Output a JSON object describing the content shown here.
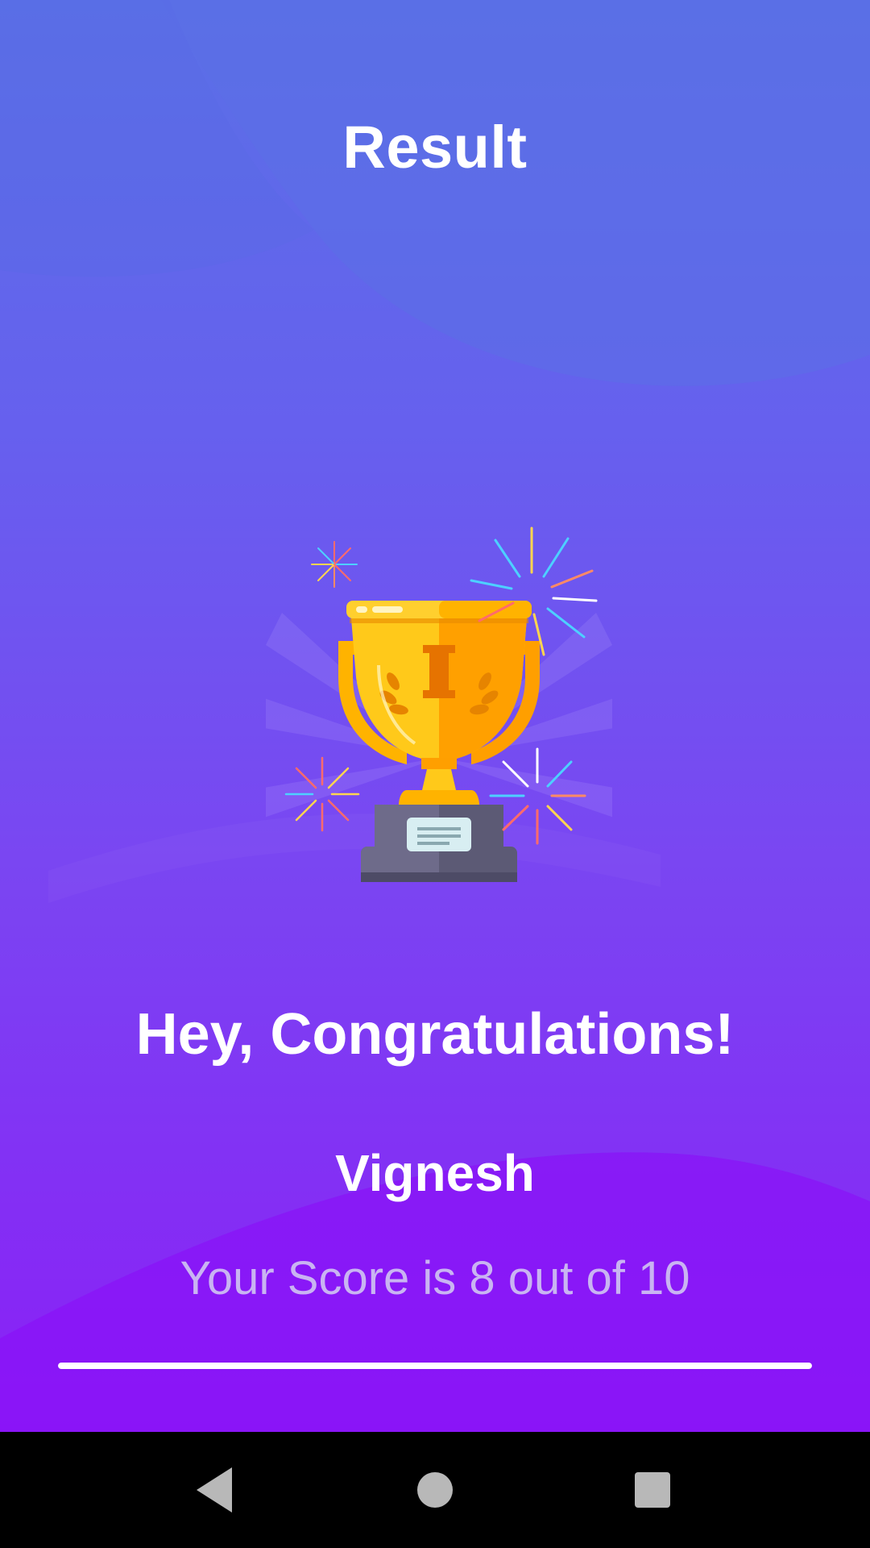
{
  "header": {
    "title": "Result"
  },
  "result": {
    "congrats_text": "Hey, Congratulations!",
    "user_name": "Vignesh",
    "score_text": "Your Score is 8 out of 10",
    "score": 8,
    "max_score": 10,
    "progress_fraction": 1.0
  },
  "icons": {
    "trophy": "trophy-icon",
    "fireworks": "fireworks-icon",
    "nav_back": "back-triangle-icon",
    "nav_home": "home-circle-icon",
    "nav_recents": "recents-square-icon"
  },
  "colors": {
    "gradient_top": "#5a70e6",
    "gradient_bottom": "#8a1ff6",
    "score_text": "#c9b4f2",
    "trophy_gold": "#ffc91a",
    "trophy_orange": "#ffa000",
    "base_gray": "#5c5a75"
  }
}
